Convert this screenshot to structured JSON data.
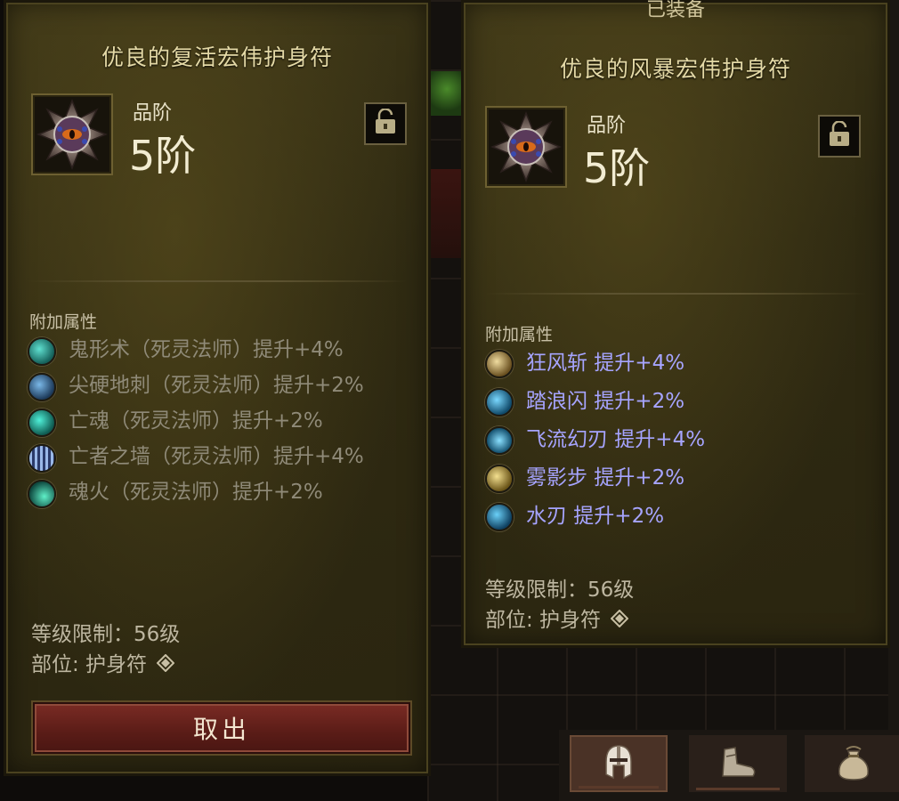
{
  "left_item": {
    "title": "优良的复活宏伟护身符",
    "tier_label": "品阶",
    "tier_value": "5阶",
    "lock_icon": "unlock-icon",
    "affix_section_title": "附加属性",
    "affixes": [
      {
        "text": "鬼形术（死灵法师）提升+4%",
        "icon": "ghost-skill-icon",
        "color": "#2aa39a"
      },
      {
        "text": "尖硬地刺（死灵法师）提升+2%",
        "icon": "bone-spikes-skill-icon",
        "color": "#3a7ab0"
      },
      {
        "text": "亡魂（死灵法师）提升+2%",
        "icon": "spirit-skill-icon",
        "color": "#23b8a6"
      },
      {
        "text": "亡者之墙（死灵法师）提升+4%",
        "icon": "wall-skill-icon",
        "color": "#4a6ea8"
      },
      {
        "text": "魂火（死灵法师）提升+2%",
        "icon": "soulfire-skill-icon",
        "color": "#1fb3a0"
      }
    ],
    "level_requirement": "等级限制：56级",
    "slot": "部位: 护身符",
    "action_button": "取出"
  },
  "right_item": {
    "equipped_label": "已装备",
    "title": "优良的风暴宏伟护身符",
    "tier_label": "品阶",
    "tier_value": "5阶",
    "lock_icon": "unlock-icon",
    "affix_section_title": "附加属性",
    "affixes": [
      {
        "text": "狂风斩  提升+4%",
        "icon": "gale-slash-skill-icon",
        "color": "#b89a5a"
      },
      {
        "text": "踏浪闪  提升+2%",
        "icon": "wave-dash-skill-icon",
        "color": "#2e9fd0"
      },
      {
        "text": "飞流幻刃  提升+4%",
        "icon": "flowing-blade-skill-icon",
        "color": "#3aa4d8"
      },
      {
        "text": "雾影步  提升+2%",
        "icon": "mist-step-skill-icon",
        "color": "#c4a450"
      },
      {
        "text": "水刃  提升+2%",
        "icon": "water-blade-skill-icon",
        "color": "#2a9ccc"
      }
    ],
    "level_requirement": "等级限制：56级",
    "slot": "部位: 护身符"
  },
  "bottom_tabs": [
    {
      "icon": "helmet-icon",
      "active": true
    },
    {
      "icon": "boots-icon",
      "active": false
    },
    {
      "icon": "bag-icon",
      "active": false
    }
  ],
  "colors": {
    "panel_bg": "#3a3315",
    "title_text": "#e4d9a6",
    "enhanced_affix_text": "#a6a4ff",
    "inactive_affix_text": "#8f8a78",
    "button_red": "#6a2420"
  }
}
